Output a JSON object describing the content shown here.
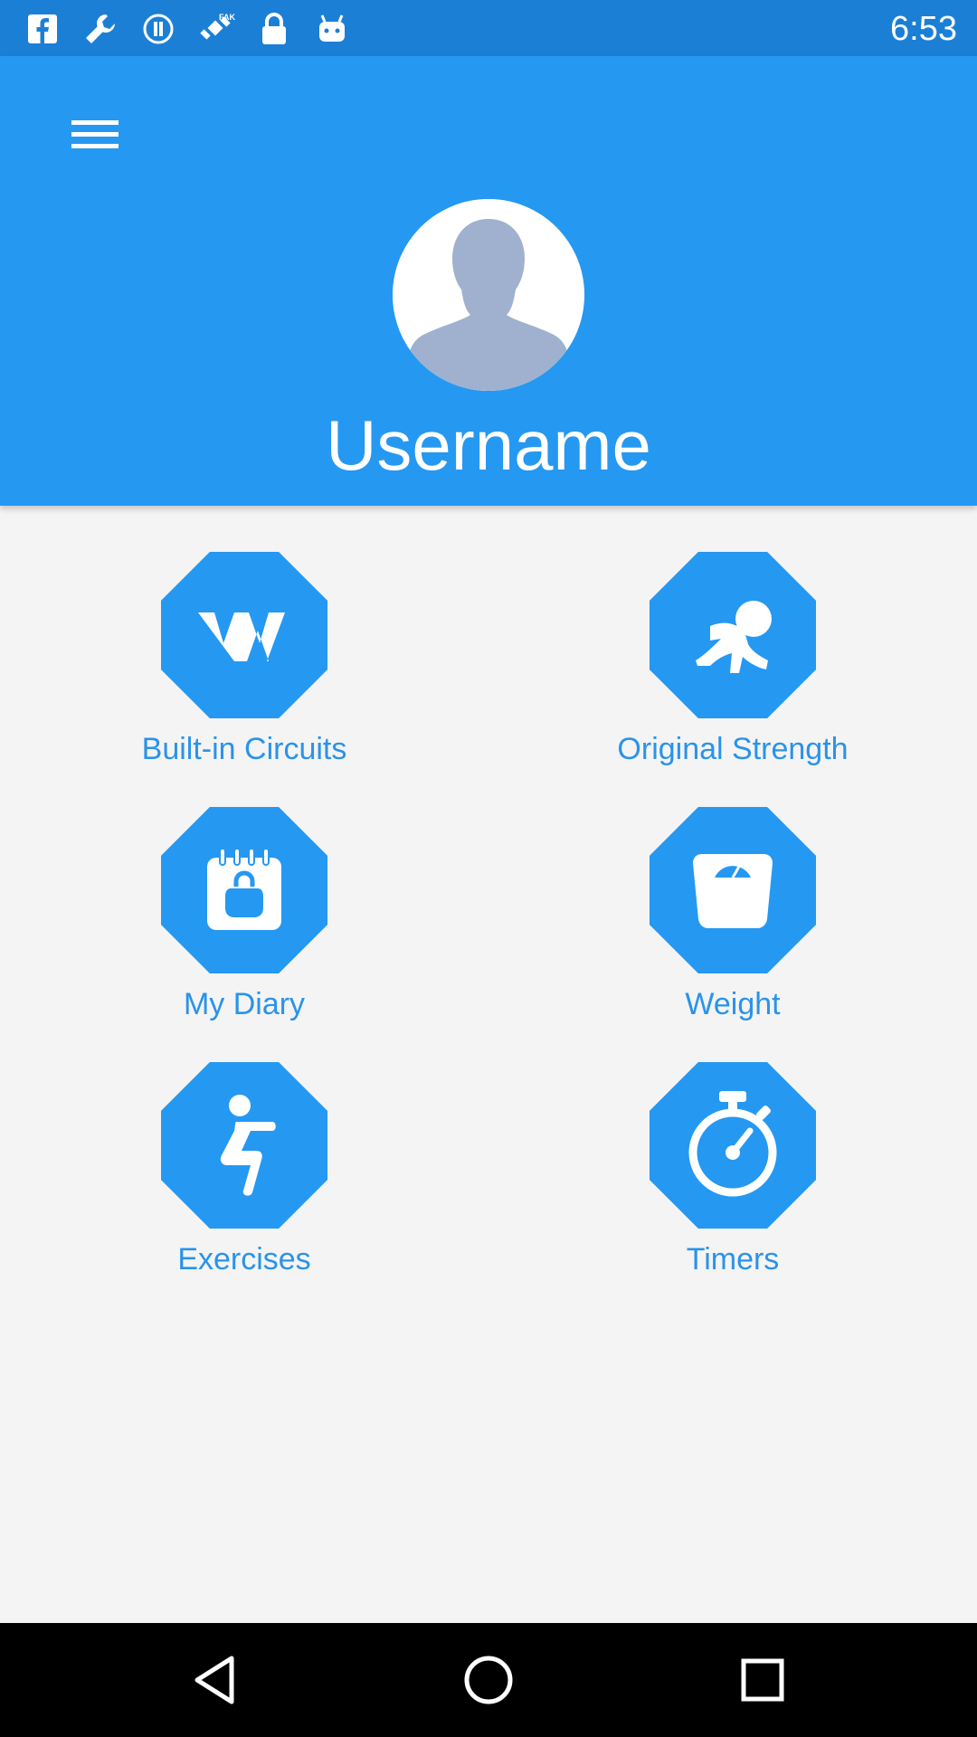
{
  "status_bar": {
    "time": "6:53",
    "icons": [
      "facebook-icon",
      "wrench-icon",
      "info-icon",
      "satellite-fake-gps-icon",
      "lock-icon",
      "android-icon"
    ]
  },
  "header": {
    "username": "Username",
    "menu_icon": "hamburger-menu-icon",
    "avatar_icon": "default-avatar-icon"
  },
  "tiles": [
    {
      "label": "Built-in Circuits",
      "icon": "w-circuit-icon"
    },
    {
      "label": "Original Strength",
      "icon": "crawling-baby-icon"
    },
    {
      "label": "My Diary",
      "icon": "calendar-kettlebell-icon"
    },
    {
      "label": "Weight",
      "icon": "scale-icon"
    },
    {
      "label": "Exercises",
      "icon": "exercise-person-icon"
    },
    {
      "label": "Timers",
      "icon": "stopwatch-icon"
    }
  ],
  "nav_bar": {
    "icons": [
      "back-icon",
      "home-icon",
      "recents-icon"
    ]
  },
  "colors": {
    "status_bar": "#1b7fd6",
    "header": "#2598f2",
    "tile": "#2598f2",
    "label": "#2a93ea",
    "background": "#f4f4f4"
  }
}
